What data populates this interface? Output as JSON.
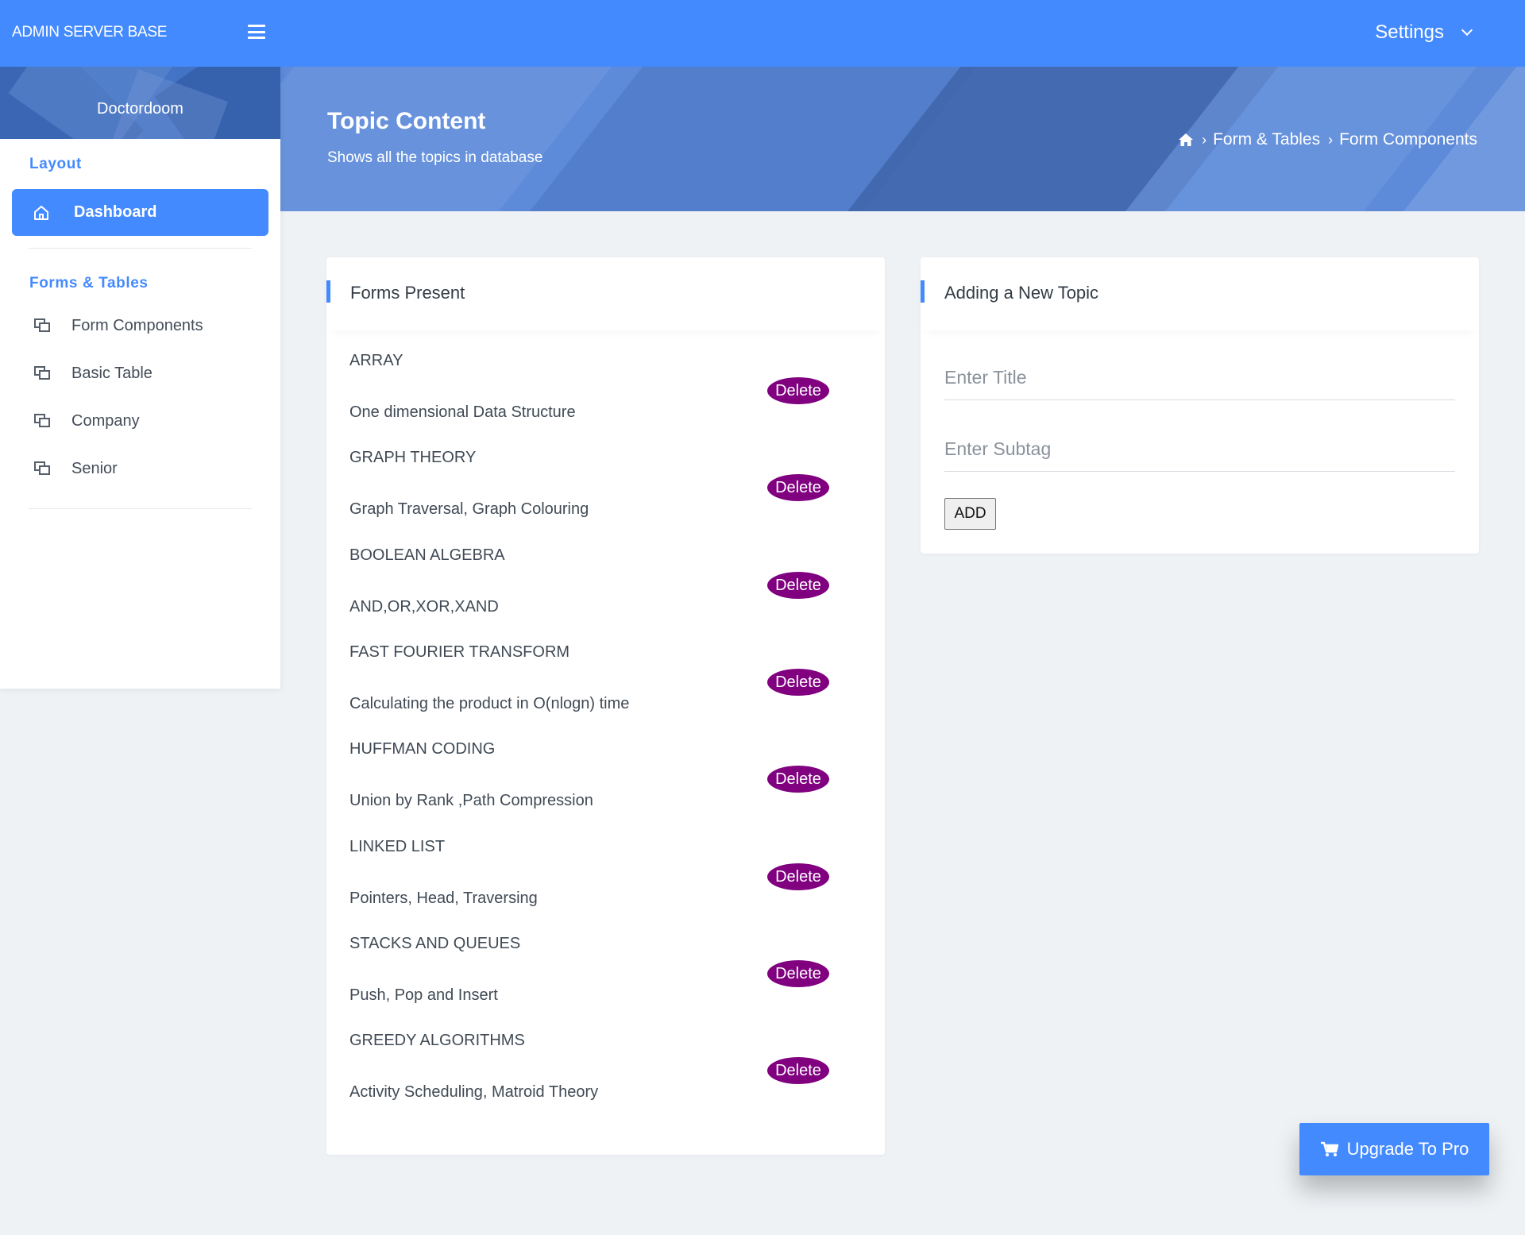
{
  "topbar": {
    "brand": "ADMIN SERVER BASE",
    "settings_label": "Settings"
  },
  "sidebar": {
    "username": "Doctordoom",
    "section_layout": "Layout",
    "active_item": "Dashboard",
    "section_forms": "Forms & Tables",
    "items": [
      {
        "label": "Form Components"
      },
      {
        "label": "Basic Table"
      },
      {
        "label": "Company"
      },
      {
        "label": "Senior"
      }
    ]
  },
  "banner": {
    "title": "Topic Content",
    "subtitle": "Shows all the topics in database",
    "breadcrumb": [
      "Form & Tables",
      "Form Components"
    ]
  },
  "forms_card": {
    "title": "Forms Present",
    "delete_label": "Delete",
    "topics": [
      {
        "name": "ARRAY",
        "sub": "One dimensional Data Structure"
      },
      {
        "name": "GRAPH THEORY",
        "sub": "Graph Traversal, Graph Colouring"
      },
      {
        "name": "BOOLEAN ALGEBRA",
        "sub": "AND,OR,XOR,XAND"
      },
      {
        "name": "FAST FOURIER TRANSFORM",
        "sub": "Calculating the product in O(nlogn) time"
      },
      {
        "name": "HUFFMAN CODING",
        "sub": "Union by Rank ,Path Compression"
      },
      {
        "name": "LINKED LIST",
        "sub": "Pointers, Head, Traversing"
      },
      {
        "name": "STACKS AND QUEUES",
        "sub": "Push, Pop and Insert"
      },
      {
        "name": "GREEDY ALGORITHMS",
        "sub": "Activity Scheduling, Matroid Theory"
      }
    ]
  },
  "add_card": {
    "title": "Adding a New Topic",
    "title_placeholder": "Enter Title",
    "subtag_placeholder": "Enter Subtag",
    "add_label": "ADD"
  },
  "upgrade": {
    "label": "Upgrade To Pro"
  },
  "colors": {
    "accent": "#448aff",
    "delete": "#800080",
    "background": "#eef2f5"
  },
  "icons": [
    "menu-icon",
    "chevron-down-icon",
    "home-icon",
    "copy-icon",
    "cart-icon"
  ]
}
